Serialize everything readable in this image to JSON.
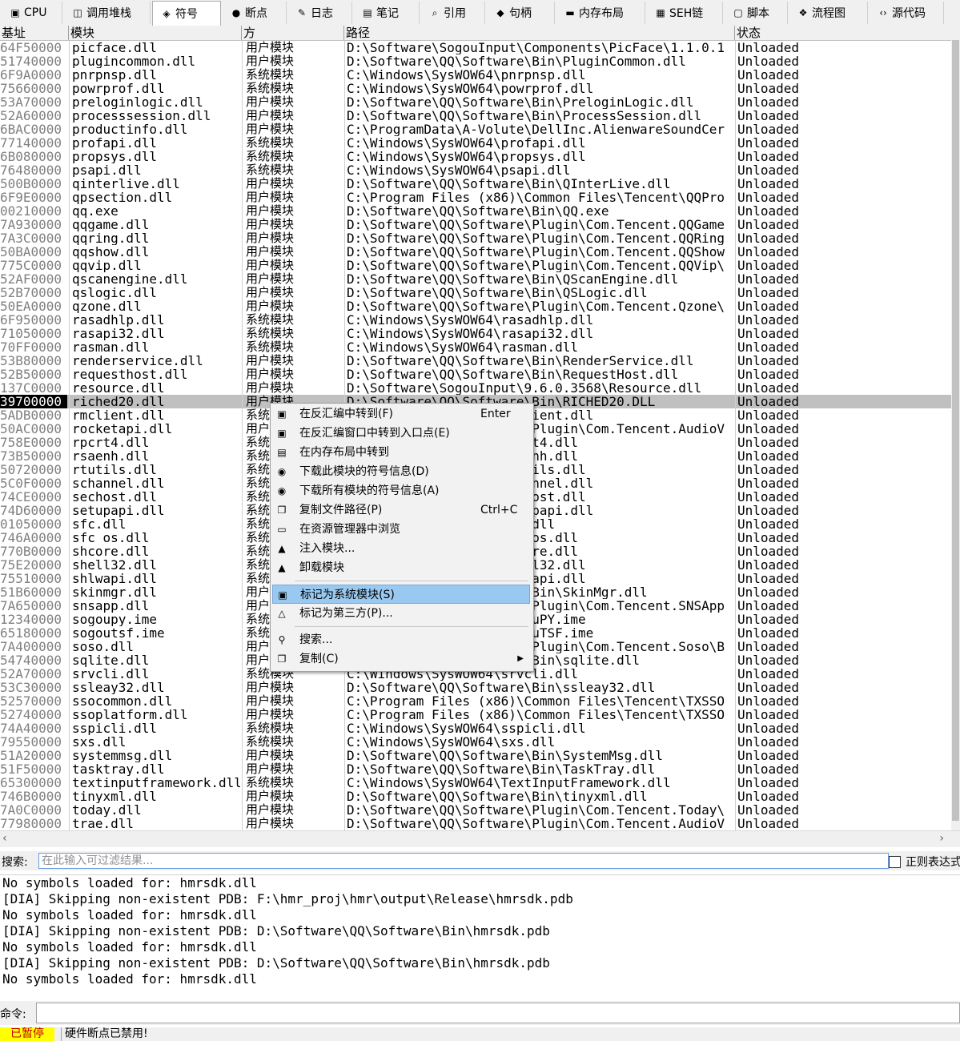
{
  "tabs": [
    {
      "label": "CPU",
      "icon": "cpu-icon",
      "glyph": "▣"
    },
    {
      "label": "调用堆栈",
      "icon": "call-stack-icon",
      "glyph": "◫"
    },
    {
      "label": "符号",
      "icon": "symbols-icon",
      "glyph": "◈",
      "active": true
    },
    {
      "label": "断点",
      "icon": "breakpoint-icon",
      "glyph": "●"
    },
    {
      "label": "日志",
      "icon": "log-icon",
      "glyph": "✎"
    },
    {
      "label": "笔记",
      "icon": "notes-icon",
      "glyph": "▤"
    },
    {
      "label": "引用",
      "icon": "references-icon",
      "glyph": "⌕"
    },
    {
      "label": "句柄",
      "icon": "handles-icon",
      "glyph": "◆"
    },
    {
      "label": "内存布局",
      "icon": "memory-map-icon",
      "glyph": "▬"
    },
    {
      "label": "SEH链",
      "icon": "seh-chain-icon",
      "glyph": "▦"
    },
    {
      "label": "脚本",
      "icon": "script-icon",
      "glyph": "▢"
    },
    {
      "label": "流程图",
      "icon": "graph-icon",
      "glyph": "❖"
    },
    {
      "label": "源代码",
      "icon": "source-icon",
      "glyph": "‹›"
    }
  ],
  "columns": {
    "base": "基址",
    "module": "模块",
    "type": "方",
    "path": "路径",
    "status": "状态"
  },
  "rows": [
    [
      "64F50000",
      "picface.dll",
      "用户模块",
      "D:\\Software\\SogouInput\\Components\\PicFace\\1.1.0.1",
      "Unloaded"
    ],
    [
      "51740000",
      "plugincommon.dll",
      "用户模块",
      "D:\\Software\\QQ\\Software\\Bin\\PluginCommon.dll",
      "Unloaded"
    ],
    [
      "6F9A0000",
      "pnrpnsp.dll",
      "系统模块",
      "C:\\Windows\\SysWOW64\\pnrpnsp.dll",
      "Unloaded"
    ],
    [
      "75660000",
      "powrprof.dll",
      "系统模块",
      "C:\\Windows\\SysWOW64\\powrprof.dll",
      "Unloaded"
    ],
    [
      "53A70000",
      "preloginlogic.dll",
      "用户模块",
      "D:\\Software\\QQ\\Software\\Bin\\PreloginLogic.dll",
      "Unloaded"
    ],
    [
      "52A60000",
      "processsession.dll",
      "用户模块",
      "D:\\Software\\QQ\\Software\\Bin\\ProcessSession.dll",
      "Unloaded"
    ],
    [
      "6BAC0000",
      "productinfo.dll",
      "用户模块",
      "C:\\ProgramData\\A-Volute\\DellInc.AlienwareSoundCer",
      "Unloaded"
    ],
    [
      "77140000",
      "profapi.dll",
      "系统模块",
      "C:\\Windows\\SysWOW64\\profapi.dll",
      "Unloaded"
    ],
    [
      "6B080000",
      "propsys.dll",
      "系统模块",
      "C:\\Windows\\SysWOW64\\propsys.dll",
      "Unloaded"
    ],
    [
      "76480000",
      "psapi.dll",
      "系统模块",
      "C:\\Windows\\SysWOW64\\psapi.dll",
      "Unloaded"
    ],
    [
      "500B0000",
      "qinterlive.dll",
      "用户模块",
      "D:\\Software\\QQ\\Software\\Bin\\QInterLive.dll",
      "Unloaded"
    ],
    [
      "6F9E0000",
      "qpsection.dll",
      "用户模块",
      "C:\\Program Files (x86)\\Common Files\\Tencent\\QQPro",
      "Unloaded"
    ],
    [
      "00210000",
      "qq.exe",
      "用户模块",
      "D:\\Software\\QQ\\Software\\Bin\\QQ.exe",
      "Unloaded"
    ],
    [
      "7A930000",
      "qqgame.dll",
      "用户模块",
      "D:\\Software\\QQ\\Software\\Plugin\\Com.Tencent.QQGame",
      "Unloaded"
    ],
    [
      "7A3C0000",
      "qqring.dll",
      "用户模块",
      "D:\\Software\\QQ\\Software\\Plugin\\Com.Tencent.QQRing",
      "Unloaded"
    ],
    [
      "50BA0000",
      "qqshow.dll",
      "用户模块",
      "D:\\Software\\QQ\\Software\\Plugin\\Com.Tencent.QQShow",
      "Unloaded"
    ],
    [
      "775C0000",
      "qqvip.dll",
      "用户模块",
      "D:\\Software\\QQ\\Software\\Plugin\\Com.Tencent.QQVip\\",
      "Unloaded"
    ],
    [
      "52AF0000",
      "qscanengine.dll",
      "用户模块",
      "D:\\Software\\QQ\\Software\\Bin\\QScanEngine.dll",
      "Unloaded"
    ],
    [
      "52B70000",
      "qslogic.dll",
      "用户模块",
      "D:\\Software\\QQ\\Software\\Bin\\QSLogic.dll",
      "Unloaded"
    ],
    [
      "50EA0000",
      "qzone.dll",
      "用户模块",
      "D:\\Software\\QQ\\Software\\Plugin\\Com.Tencent.Qzone\\",
      "Unloaded"
    ],
    [
      "6F950000",
      "rasadhlp.dll",
      "系统模块",
      "C:\\Windows\\SysWOW64\\rasadhlp.dll",
      "Unloaded"
    ],
    [
      "71050000",
      "rasapi32.dll",
      "系统模块",
      "C:\\Windows\\SysWOW64\\rasapi32.dll",
      "Unloaded"
    ],
    [
      "70FF0000",
      "rasman.dll",
      "系统模块",
      "C:\\Windows\\SysWOW64\\rasman.dll",
      "Unloaded"
    ],
    [
      "53B80000",
      "renderservice.dll",
      "用户模块",
      "D:\\Software\\QQ\\Software\\Bin\\RenderService.dll",
      "Unloaded"
    ],
    [
      "52B50000",
      "requesthost.dll",
      "用户模块",
      "D:\\Software\\QQ\\Software\\Bin\\RequestHost.dll",
      "Unloaded"
    ],
    [
      "137C0000",
      "resource.dll",
      "用户模块",
      "D:\\Software\\SogouInput\\9.6.0.3568\\Resource.dll",
      "Unloaded"
    ],
    [
      "39700000",
      "riched20.dll",
      "用户模块",
      "D:\\Software\\QQ\\Software\\Bin\\RICHED20.DLL",
      "Unloaded"
    ],
    [
      "5ADB0000",
      "rmclient.dll",
      "系统模块",
      "C:\\Windows\\SysWOW64\\rmclient.dll",
      "Unloaded"
    ],
    [
      "50AC0000",
      "rocketapi.dll",
      "用户模块",
      "D:\\Software\\QQ\\Software\\Plugin\\Com.Tencent.AudioV",
      "Unloaded"
    ],
    [
      "758E0000",
      "rpcrt4.dll",
      "系统模块",
      "C:\\Windows\\SysWOW64\\rpcrt4.dll",
      "Unloaded"
    ],
    [
      "73B50000",
      "rsaenh.dll",
      "系统模块",
      "C:\\Windows\\SysWOW64\\rsaenh.dll",
      "Unloaded"
    ],
    [
      "50720000",
      "rtutils.dll",
      "系统模块",
      "C:\\Windows\\SysWOW64\\rtutils.dll",
      "Unloaded"
    ],
    [
      "5C0F0000",
      "schannel.dll",
      "系统模块",
      "C:\\Windows\\SysWOW64\\schannel.dll",
      "Unloaded"
    ],
    [
      "74CE0000",
      "sechost.dll",
      "系统模块",
      "C:\\Windows\\SysWOW64\\sechost.dll",
      "Unloaded"
    ],
    [
      "74D60000",
      "setupapi.dll",
      "系统模块",
      "C:\\Windows\\SysWOW64\\setupapi.dll",
      "Unloaded"
    ],
    [
      "01050000",
      "sfc.dll",
      "系统模块",
      "C:\\Windows\\SysWOW64\\sfc.dll",
      "Unloaded"
    ],
    [
      "746A0000",
      "sfc_os.dll",
      "系统模块",
      "C:\\Windows\\SysWOW64\\sfc_os.dll",
      "Unloaded"
    ],
    [
      "770B0000",
      "shcore.dll",
      "系统模块",
      "C:\\Windows\\SysWOW64\\shcore.dll",
      "Unloaded"
    ],
    [
      "75E20000",
      "shell32.dll",
      "系统模块",
      "C:\\Windows\\SysWOW64\\shell32.dll",
      "Unloaded"
    ],
    [
      "75510000",
      "shlwapi.dll",
      "系统模块",
      "C:\\Windows\\SysWOW64\\shlwapi.dll",
      "Unloaded"
    ],
    [
      "51B60000",
      "skinmgr.dll",
      "用户模块",
      "D:\\Software\\QQ\\Software\\Bin\\SkinMgr.dll",
      "Unloaded"
    ],
    [
      "7A650000",
      "snsapp.dll",
      "用户模块",
      "D:\\Software\\QQ\\Software\\Plugin\\Com.Tencent.SNSApp",
      "Unloaded"
    ],
    [
      "12340000",
      "sogoupy.ime",
      "系统模块",
      "C:\\Windows\\SysWOW64\\SogouPY.ime",
      "Unloaded"
    ],
    [
      "65180000",
      "sogoutsf.ime",
      "系统模块",
      "C:\\Windows\\SysWOW64\\SogouTSF.ime",
      "Unloaded"
    ],
    [
      "7A400000",
      "soso.dll",
      "用户模块",
      "D:\\Software\\QQ\\Software\\Plugin\\Com.Tencent.Soso\\B",
      "Unloaded"
    ],
    [
      "54740000",
      "sqlite.dll",
      "用户模块",
      "D:\\Software\\QQ\\Software\\Bin\\sqlite.dll",
      "Unloaded"
    ],
    [
      "52A70000",
      "srvcli.dll",
      "系统模块",
      "C:\\Windows\\SysWOW64\\srvcli.dll",
      "Unloaded"
    ],
    [
      "53C30000",
      "ssleay32.dll",
      "用户模块",
      "D:\\Software\\QQ\\Software\\Bin\\ssleay32.dll",
      "Unloaded"
    ],
    [
      "52570000",
      "ssocommon.dll",
      "用户模块",
      "C:\\Program Files (x86)\\Common Files\\Tencent\\TXSSO",
      "Unloaded"
    ],
    [
      "52740000",
      "ssoplatform.dll",
      "用户模块",
      "C:\\Program Files (x86)\\Common Files\\Tencent\\TXSSO",
      "Unloaded"
    ],
    [
      "74A40000",
      "sspicli.dll",
      "系统模块",
      "C:\\Windows\\SysWOW64\\sspicli.dll",
      "Unloaded"
    ],
    [
      "79550000",
      "sxs.dll",
      "系统模块",
      "C:\\Windows\\SysWOW64\\sxs.dll",
      "Unloaded"
    ],
    [
      "51A20000",
      "systemmsg.dll",
      "用户模块",
      "D:\\Software\\QQ\\Software\\Bin\\SystemMsg.dll",
      "Unloaded"
    ],
    [
      "51F50000",
      "tasktray.dll",
      "用户模块",
      "D:\\Software\\QQ\\Software\\Bin\\TaskTray.dll",
      "Unloaded"
    ],
    [
      "65300000",
      "textinputframework.dll",
      "系统模块",
      "C:\\Windows\\SysWOW64\\TextInputFramework.dll",
      "Unloaded"
    ],
    [
      "746B0000",
      "tinyxml.dll",
      "用户模块",
      "D:\\Software\\QQ\\Software\\Bin\\tinyxml.dll",
      "Unloaded"
    ],
    [
      "7A0C0000",
      "today.dll",
      "用户模块",
      "D:\\Software\\QQ\\Software\\Plugin\\Com.Tencent.Today\\",
      "Unloaded"
    ],
    [
      "77980000",
      "trae.dll",
      "用户模块",
      "D:\\Software\\QQ\\Software\\Plugin\\Com.Tencent.AudioV",
      "Unloaded"
    ]
  ],
  "selected_row": 26,
  "context_menu": [
    {
      "label": "在反汇编中转到(F)",
      "shortcut": "Enter",
      "icon": "disassembly-icon",
      "glyph": "▣"
    },
    {
      "label": "在反汇编窗口中转到入口点(E)",
      "shortcut": "",
      "icon": "entry-point-icon",
      "glyph": "▣"
    },
    {
      "label": "在内存布局中转到",
      "shortcut": "",
      "icon": "memory-map-icon",
      "glyph": "▤"
    },
    {
      "label": "下载此模块的符号信息(D)",
      "shortcut": "",
      "icon": "download-symbol-icon",
      "glyph": "◉"
    },
    {
      "label": "下载所有模块的符号信息(A)",
      "shortcut": "",
      "icon": "download-all-symbols-icon",
      "glyph": "◉"
    },
    {
      "label": "复制文件路径(P)",
      "shortcut": "Ctrl+C",
      "icon": "copy-path-icon",
      "glyph": "❐"
    },
    {
      "label": "在资源管理器中浏览",
      "shortcut": "",
      "icon": "explorer-icon",
      "glyph": "▭"
    },
    {
      "label": "注入模块...",
      "shortcut": "",
      "icon": "inject-module-icon",
      "glyph": "▲"
    },
    {
      "label": "卸载模块",
      "shortcut": "",
      "icon": "unload-module-icon",
      "glyph": "▲"
    },
    {
      "separator": true
    },
    {
      "label": "标记为系统模块(S)",
      "shortcut": "",
      "icon": "mark-system-icon",
      "glyph": "▣",
      "highlighted": true
    },
    {
      "label": "标记为第三方(P)...",
      "shortcut": "",
      "icon": "mark-third-party-icon",
      "glyph": "△"
    },
    {
      "separator": true
    },
    {
      "label": "搜索...",
      "shortcut": "",
      "icon": "binoculars-icon",
      "glyph": "⚲"
    },
    {
      "label": "复制(C)",
      "shortcut": "",
      "icon": "copy-icon",
      "glyph": "❐",
      "submenu": true
    }
  ],
  "search": {
    "label": "搜索:",
    "placeholder": "在此输入可过滤结果...",
    "regex_label": "正则表达式"
  },
  "log": [
    "No symbols loaded for: hmrsdk.dll",
    "[DIA] Skipping non-existent PDB: F:\\hmr_proj\\hmr\\output\\Release\\hmrsdk.pdb",
    "No symbols loaded for: hmrsdk.dll",
    "[DIA] Skipping non-existent PDB: D:\\Software\\QQ\\Software\\Bin\\hmrsdk.pdb",
    "No symbols loaded for: hmrsdk.dll",
    "[DIA] Skipping non-existent PDB: D:\\Software\\QQ\\Software\\Bin\\hmrsdk.pdb",
    "No symbols loaded for: hmrsdk.dll"
  ],
  "command": {
    "label": "命令:",
    "value": ""
  },
  "status": {
    "state": "已暂停",
    "message": "硬件断点已禁用!",
    "state_bg": "#ffff00",
    "state_fg": "#c00000"
  },
  "colors": {
    "selection": "#c0c0c0",
    "menu_highlight": "#99c9f0",
    "address_gray": "#808080"
  }
}
